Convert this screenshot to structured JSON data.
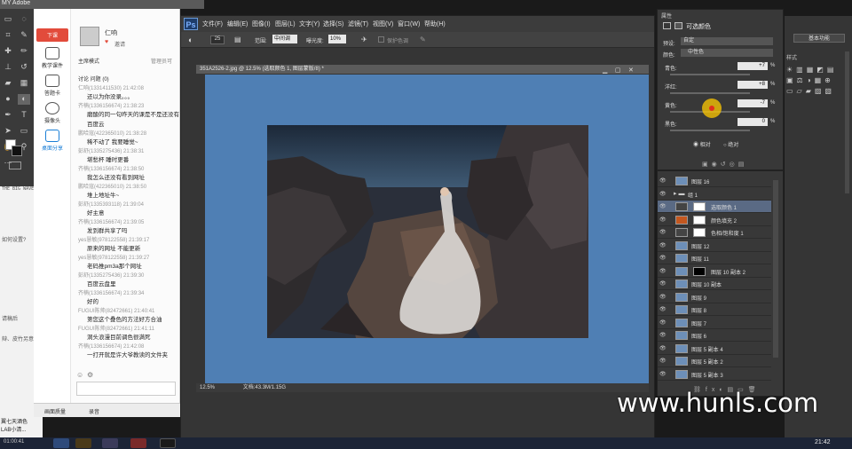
{
  "window_title": "MY Adobe",
  "chat": {
    "side_buttons": [
      {
        "label": "下课"
      },
      {
        "label": "教学课件"
      },
      {
        "label": "答题卡"
      },
      {
        "label": "摄像头"
      },
      {
        "label": "桌面分享"
      }
    ],
    "user_name": "仁响",
    "invite": "邀请",
    "mode": "主席模式",
    "manage": "管理员可",
    "tabs": "讨论  问题 (0)",
    "messages": [
      {
        "meta": "仁响(1331411530) 21:42:08",
        "body": ""
      },
      {
        "meta": "",
        "body": "还以为你没录。。。"
      },
      {
        "meta": "齐楠(1336156674) 21:38:23",
        "body": ""
      },
      {
        "meta": "",
        "body": "磨酸的同一句昨天的课是不是还没有"
      },
      {
        "meta": "",
        "body": "百度云"
      },
      {
        "meta": "鹏哈寇(422365010) 21:38:28",
        "body": "稀不动了 我要睡觉~"
      },
      {
        "meta": "彭舒(1335275436) 21:38:31",
        "body": "堪愁杯 睡时更番"
      },
      {
        "meta": "齐楠(1336156674) 21:38:50",
        "body": "我怎么还没有看到网址"
      },
      {
        "meta": "鹏哈寇(422365010) 21:38:50",
        "body": "堆上地址牛~"
      },
      {
        "meta": "彭舒(1335393118) 21:39:04",
        "body": "好主意"
      },
      {
        "meta": "齐楠(1336156674) 21:39:05",
        "body": "发到群共享了吗"
      },
      {
        "meta": "yes慧敏(978122558) 21:39:17",
        "body": "原来的网址 不能更新"
      },
      {
        "meta": "yes慧敏(978122558) 21:39:27",
        "body": "老码推pm3a那个网址"
      },
      {
        "meta": "彭舒(1335275436) 21:39:30",
        "body": "百度云盘里"
      },
      {
        "meta": "齐楠(1336156674) 21:39:34",
        "body": "好的"
      },
      {
        "meta": "FUGUI陈帅(82472661) 21:40:41",
        "body": "第您这个叠色的方法好方合油"
      },
      {
        "meta": "FUGUI陈帅(82472661) 21:41:11",
        "body": "洞头浪漫目前调色很满死"
      },
      {
        "meta": "齐楠(1336156674) 21:42:08",
        "body": "一打开就是许大爷教读的文件夹"
      }
    ],
    "bottom_left": "画面质量",
    "bottom_right": "录音",
    "left_texts": [
      "THE BIG WAVE",
      "如何设置?",
      "请稿后",
      "辩、皮竹另意平"
    ],
    "left_stubs": [
      "翼七天酒色",
      "LAB小清..."
    ]
  },
  "photoshop": {
    "logo": "Ps",
    "menus": [
      "文件(F)",
      "编辑(E)",
      "图像(I)",
      "图层(L)",
      "文字(Y)",
      "选择(S)",
      "滤镜(T)",
      "视图(V)",
      "窗口(W)",
      "帮助(H)"
    ],
    "options": {
      "size": "25",
      "range_label": "范围:",
      "range_value": "中间调",
      "exposure_label": "曝光度:",
      "exposure_value": "10%",
      "protect": "保护色调"
    },
    "doc_tab": "351A2526-2.jpg @ 12.5% (选取颜色 1, 图层蒙版/8) *",
    "zoom": "12.5%",
    "doc_info": "文档:43.3M/1.15G"
  },
  "properties": {
    "title": "属性",
    "header": "可选颜色",
    "preset_label": "预设:",
    "preset_value": "自定",
    "color_label": "颜色:",
    "color_value": "中性色",
    "sliders": [
      {
        "label": "青色:",
        "value": "+7",
        "unit": "%"
      },
      {
        "label": "洋红:",
        "value": "+8",
        "unit": "%"
      },
      {
        "label": "黄色:",
        "value": "-7",
        "unit": "%"
      },
      {
        "label": "黑色:",
        "value": "0",
        "unit": "%"
      }
    ],
    "relative": "相对",
    "absolute": "绝对"
  },
  "layers": [
    {
      "name": "图层 16",
      "kind": "photo",
      "selected": false
    },
    {
      "name": "组 1",
      "kind": "group",
      "selected": false
    },
    {
      "name": "选取颜色 1",
      "kind": "adj",
      "selected": true
    },
    {
      "name": "颜色填充 2",
      "kind": "fill",
      "selected": false
    },
    {
      "name": "色相/饱和度 1",
      "kind": "adj",
      "selected": false
    },
    {
      "name": "图层 12",
      "kind": "photo",
      "selected": false
    },
    {
      "name": "图层 11",
      "kind": "photo",
      "selected": false
    },
    {
      "name": "图层 10 副本 2",
      "kind": "mask",
      "selected": false
    },
    {
      "name": "图层 10 副本",
      "kind": "photo",
      "selected": false
    },
    {
      "name": "图层 9",
      "kind": "photo",
      "selected": false
    },
    {
      "name": "图层 8",
      "kind": "photo",
      "selected": false
    },
    {
      "name": "图层 7",
      "kind": "photo",
      "selected": false
    },
    {
      "name": "图层 6",
      "kind": "photo",
      "selected": false
    },
    {
      "name": "图层 5 副本 4",
      "kind": "photo",
      "selected": false
    },
    {
      "name": "图层 5 副本 2",
      "kind": "photo",
      "selected": false
    },
    {
      "name": "图层 5 副本 3",
      "kind": "photo",
      "selected": false
    }
  ],
  "essentials": {
    "label": "基本功能",
    "style_tab": "样式"
  },
  "taskbar": {
    "time": "21:42",
    "left_time": "01:00:41"
  },
  "watermark": "www.hunls.com",
  "colors": {
    "canvas_bg": "#4f7fb4",
    "ps_bg": "#353535",
    "accent_red": "#e24b3b",
    "chat_blue": "#1b7fd6"
  }
}
